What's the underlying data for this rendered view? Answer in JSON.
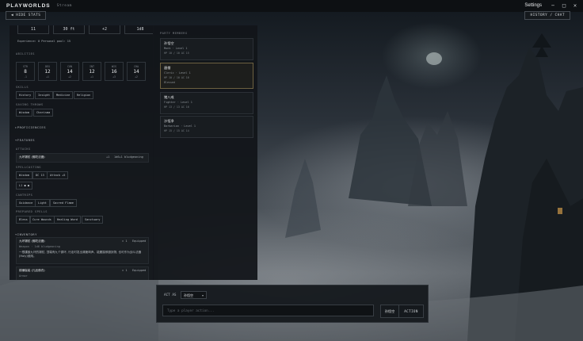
{
  "app": {
    "brand": "PLAYWORLDS",
    "stream_label": "Stream",
    "settings_label": "Settings",
    "window_controls": [
      "−",
      "□",
      "✕"
    ],
    "hide_stats_label": "◀ HIDE STATS",
    "history_chat_label": "HISTORY / CHAT"
  },
  "stats": {
    "top_values": [
      "11",
      "30 ft",
      "+2",
      "1d8"
    ],
    "experience": "Experience: 0   Personal pool: 15",
    "abilities_heading": "ABILITIES",
    "abilities": [
      {
        "name": "STR",
        "value": "8",
        "mod": "-1"
      },
      {
        "name": "DEX",
        "value": "12",
        "mod": "+1"
      },
      {
        "name": "CON",
        "value": "14",
        "mod": "+2"
      },
      {
        "name": "INT",
        "value": "12",
        "mod": "+1"
      },
      {
        "name": "WIS",
        "value": "16",
        "mod": "+3"
      },
      {
        "name": "CHA",
        "value": "14",
        "mod": "+2"
      }
    ],
    "skills_heading": "SKILLS",
    "skills": [
      "History",
      "Insight",
      "Medicine",
      "Religion"
    ],
    "saving_heading": "SAVING THROWS",
    "saving": [
      "Wisdom",
      "Charisma"
    ],
    "proficiencies_heading": "▸PROFICIENCIES",
    "features_heading": "▾FEATURES",
    "attacks_heading": "ATTACKS",
    "attack": {
      "name": "九环锡杖 (佛陀法器)",
      "bonus": "+1",
      "damage": "1d6+1 bludgeoning"
    },
    "spellcasting_heading": "SPELLCASTING",
    "spellcasting": [
      "Wisdom",
      "DC 13",
      "Attack +5"
    ],
    "slots": "L1 ● ●",
    "cantrips_heading": "CANTRIPS",
    "cantrips": [
      "Guidance",
      "Light",
      "Sacred Flame"
    ],
    "prepared_heading": "PREPARED SPELLS",
    "prepared": [
      "Bless",
      "Cure Wounds",
      "Healing Word",
      "Sanctuary"
    ],
    "inventory_heading": "▾INVENTORY",
    "items": [
      {
        "name": "九环锡杖 (佛陀法器)",
        "count": "× 1",
        "status": "Equipped",
        "sub": "Weapon · 1d6 bludgeoning",
        "desc": "一根镶嵌九环的锡杖, 顶端有九个铜环, 行走时发出清脆响声。能震摄邪魔妖物, 也可作为战斗法器(Holy)使用。"
      },
      {
        "name": "锦襕袈裟 (凡品佛衣)",
        "count": "× 1",
        "status": "Equipped",
        "sub": "Armor"
      }
    ]
  },
  "party": {
    "heading": "PARTY MEMBERS",
    "members": [
      {
        "name": "孙悟空",
        "class": "Monk · Level 1",
        "hp": "HP 10 / 10   AC 15",
        "selected": false
      },
      {
        "name": "唐僧",
        "class": "Cleric · Level 1",
        "hp": "HP 10 / 10   AC 16",
        "status": "Blessed",
        "selected": true
      },
      {
        "name": "猪八戒",
        "class": "Fighter · Level 1",
        "hp": "HP 13 / 13   AC 16",
        "selected": false
      },
      {
        "name": "沙悟净",
        "class": "Barbarian · Level 1",
        "hp": "HP 15 / 15   AC 14",
        "selected": false
      }
    ]
  },
  "action": {
    "act_label": "ACT AS",
    "act_as_value": "孙悟空",
    "input_placeholder": "Type a player action...",
    "actor_name": "孙悟空",
    "submit_label": "ACTION"
  }
}
